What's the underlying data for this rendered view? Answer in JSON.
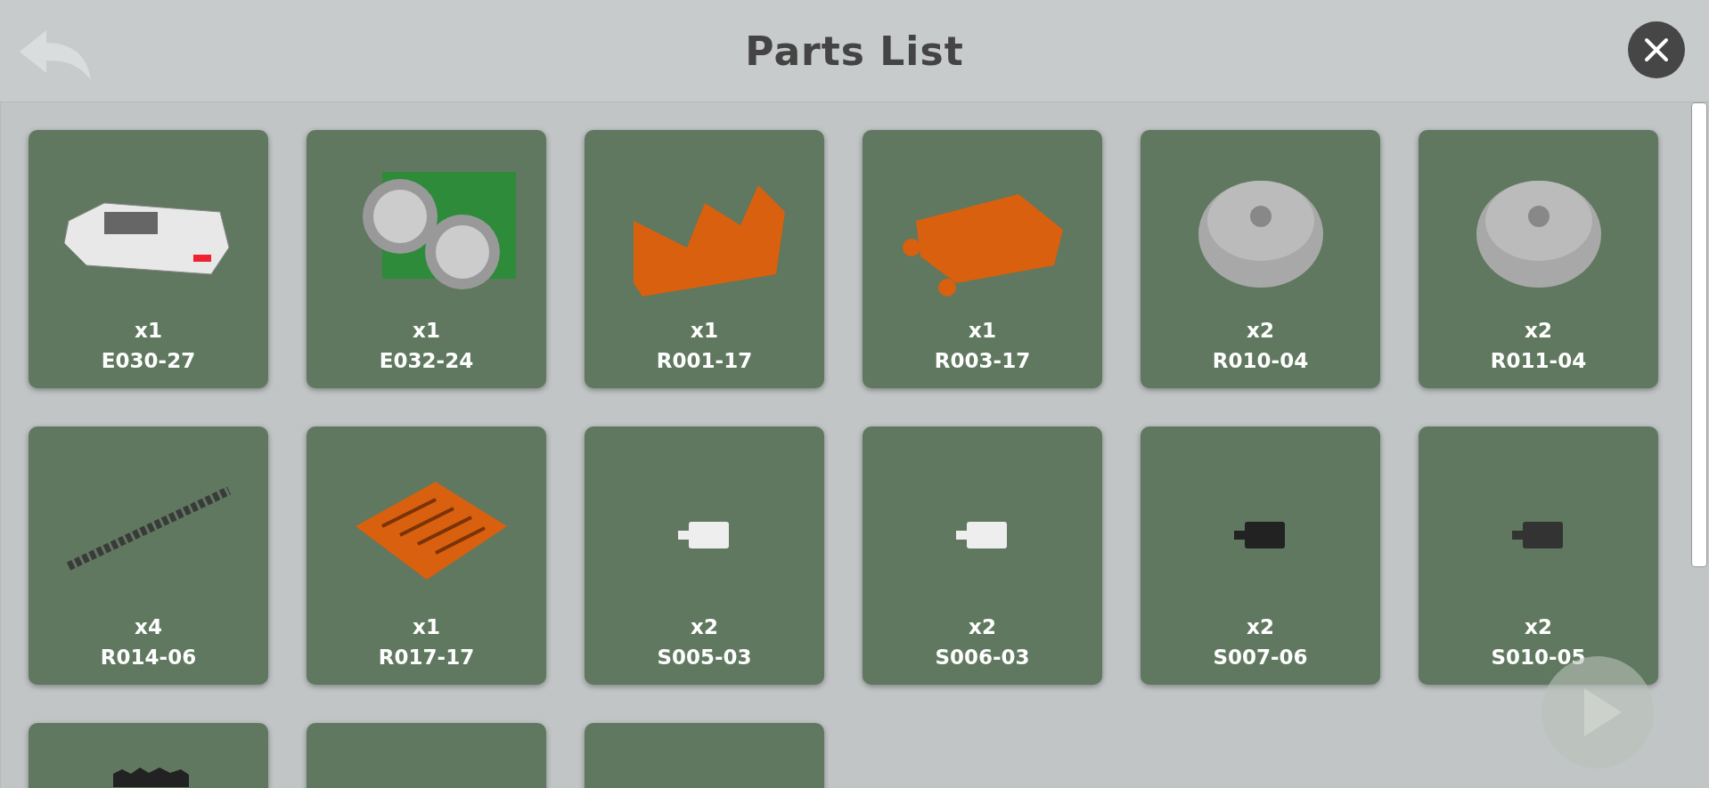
{
  "header": {
    "title": "Parts List"
  },
  "parts": [
    {
      "quantity": "x1",
      "code": "E030-27",
      "kind": "module",
      "color": "#e8e8e8"
    },
    {
      "quantity": "x1",
      "code": "E032-24",
      "kind": "sensor",
      "color": "#2e8b3a"
    },
    {
      "quantity": "x1",
      "code": "R001-17",
      "kind": "bracket",
      "color": "#d9600e"
    },
    {
      "quantity": "x1",
      "code": "R003-17",
      "kind": "plate",
      "color": "#d9600e"
    },
    {
      "quantity": "x2",
      "code": "R010-04",
      "kind": "wheel",
      "color": "#a8a8a8"
    },
    {
      "quantity": "x2",
      "code": "R011-04",
      "kind": "wheel",
      "color": "#a8a8a8"
    },
    {
      "quantity": "x4",
      "code": "R014-06",
      "kind": "chain",
      "color": "#3a3a3a"
    },
    {
      "quantity": "x1",
      "code": "R017-17",
      "kind": "frame",
      "color": "#d9600e"
    },
    {
      "quantity": "x2",
      "code": "S005-03",
      "kind": "connector",
      "color": "#eeeeee"
    },
    {
      "quantity": "x2",
      "code": "S006-03",
      "kind": "connector",
      "color": "#eeeeee"
    },
    {
      "quantity": "x2",
      "code": "S007-06",
      "kind": "connector",
      "color": "#222222"
    },
    {
      "quantity": "x2",
      "code": "S010-05",
      "kind": "connector",
      "color": "#333333"
    }
  ],
  "cut_off_parts": [
    {
      "picture_shown": true,
      "kind": "gear",
      "color": "#222222"
    },
    {
      "picture_shown": false
    },
    {
      "picture_shown": false
    }
  ]
}
